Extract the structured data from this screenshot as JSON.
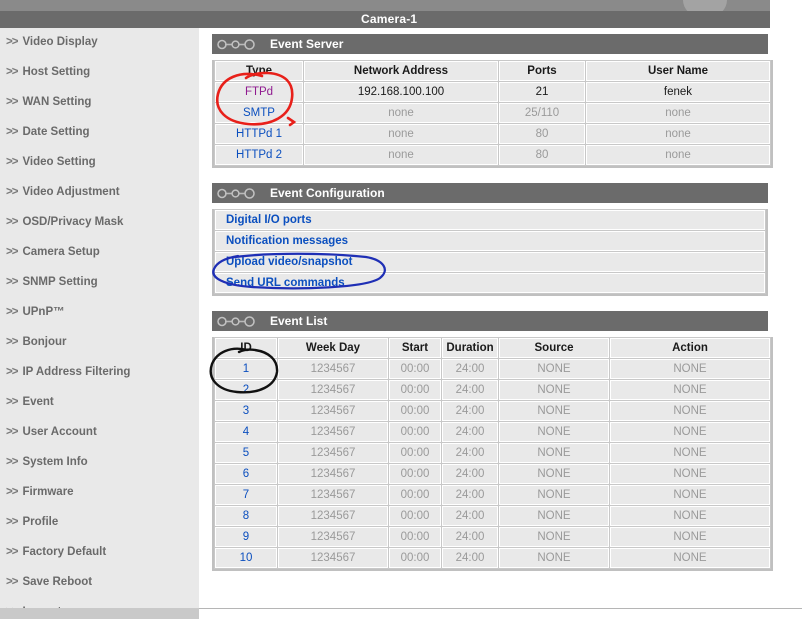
{
  "titlebar": {
    "title": "Camera-1"
  },
  "sidebar": {
    "arrow": ">>",
    "items": [
      {
        "label": "Video Display"
      },
      {
        "label": "Host Setting"
      },
      {
        "label": "WAN Setting"
      },
      {
        "label": "Date Setting"
      },
      {
        "label": "Video Setting"
      },
      {
        "label": "Video Adjustment"
      },
      {
        "label": "OSD/Privacy Mask"
      },
      {
        "label": "Camera Setup"
      },
      {
        "label": "SNMP Setting"
      },
      {
        "label": "UPnP™"
      },
      {
        "label": "Bonjour"
      },
      {
        "label": "IP Address Filtering"
      },
      {
        "label": "Event"
      },
      {
        "label": "User Account"
      },
      {
        "label": "System Info"
      },
      {
        "label": "Firmware"
      },
      {
        "label": "Profile"
      },
      {
        "label": "Factory Default"
      },
      {
        "label": "Save Reboot"
      },
      {
        "label": "Logout"
      }
    ]
  },
  "event_server": {
    "title": "Event Server",
    "columns": [
      "Type",
      "Network Address",
      "Ports",
      "User Name"
    ],
    "rows": [
      {
        "type": "FTPd",
        "type_state": "visited",
        "address": "192.168.100.100",
        "address_state": "dark",
        "ports": "21",
        "ports_state": "dark",
        "user": "fenek",
        "user_state": "dark"
      },
      {
        "type": "SMTP",
        "type_state": "link",
        "address": "none",
        "address_state": "dim",
        "ports": "25/110",
        "ports_state": "dim",
        "user": "none",
        "user_state": "dim"
      },
      {
        "type": "HTTPd 1",
        "type_state": "link",
        "address": "none",
        "address_state": "dim",
        "ports": "80",
        "ports_state": "dim",
        "user": "none",
        "user_state": "dim"
      },
      {
        "type": "HTTPd 2",
        "type_state": "link",
        "address": "none",
        "address_state": "dim",
        "ports": "80",
        "ports_state": "dim",
        "user": "none",
        "user_state": "dim"
      }
    ]
  },
  "event_configuration": {
    "title": "Event Configuration",
    "items": [
      {
        "label": "Digital I/O ports"
      },
      {
        "label": "Notification messages"
      },
      {
        "label": "Upload video/snapshot"
      },
      {
        "label": "Send URL commands"
      }
    ]
  },
  "event_list": {
    "title": "Event List",
    "columns": [
      "ID",
      "Week Day",
      "Start",
      "Duration",
      "Source",
      "Action"
    ],
    "rows": [
      {
        "id": "1",
        "week_day": "1234567",
        "start": "00:00",
        "duration": "24:00",
        "source": "NONE",
        "action": "NONE"
      },
      {
        "id": "2",
        "week_day": "1234567",
        "start": "00:00",
        "duration": "24:00",
        "source": "NONE",
        "action": "NONE"
      },
      {
        "id": "3",
        "week_day": "1234567",
        "start": "00:00",
        "duration": "24:00",
        "source": "NONE",
        "action": "NONE"
      },
      {
        "id": "4",
        "week_day": "1234567",
        "start": "00:00",
        "duration": "24:00",
        "source": "NONE",
        "action": "NONE"
      },
      {
        "id": "5",
        "week_day": "1234567",
        "start": "00:00",
        "duration": "24:00",
        "source": "NONE",
        "action": "NONE"
      },
      {
        "id": "6",
        "week_day": "1234567",
        "start": "00:00",
        "duration": "24:00",
        "source": "NONE",
        "action": "NONE"
      },
      {
        "id": "7",
        "week_day": "1234567",
        "start": "00:00",
        "duration": "24:00",
        "source": "NONE",
        "action": "NONE"
      },
      {
        "id": "8",
        "week_day": "1234567",
        "start": "00:00",
        "duration": "24:00",
        "source": "NONE",
        "action": "NONE"
      },
      {
        "id": "9",
        "week_day": "1234567",
        "start": "00:00",
        "duration": "24:00",
        "source": "NONE",
        "action": "NONE"
      },
      {
        "id": "10",
        "week_day": "1234567",
        "start": "00:00",
        "duration": "24:00",
        "source": "NONE",
        "action": "NONE"
      }
    ]
  },
  "annotations": [
    {
      "name": "red-ellipse-ftpd",
      "color": "#e8201a",
      "target": "FTPd"
    },
    {
      "name": "blue-ellipse-upload",
      "color": "#1f2fb5",
      "target": "Upload video/snapshot"
    },
    {
      "name": "black-ellipse-id-1",
      "color": "#111111",
      "target": "1"
    }
  ],
  "colors": {
    "titlebar": "#6b6b6b",
    "sidebar_bg": "#e9e9e9",
    "link": "#0b4fbf",
    "link_visited": "#8f1a8f",
    "disabled_text": "#9a9a9a"
  }
}
